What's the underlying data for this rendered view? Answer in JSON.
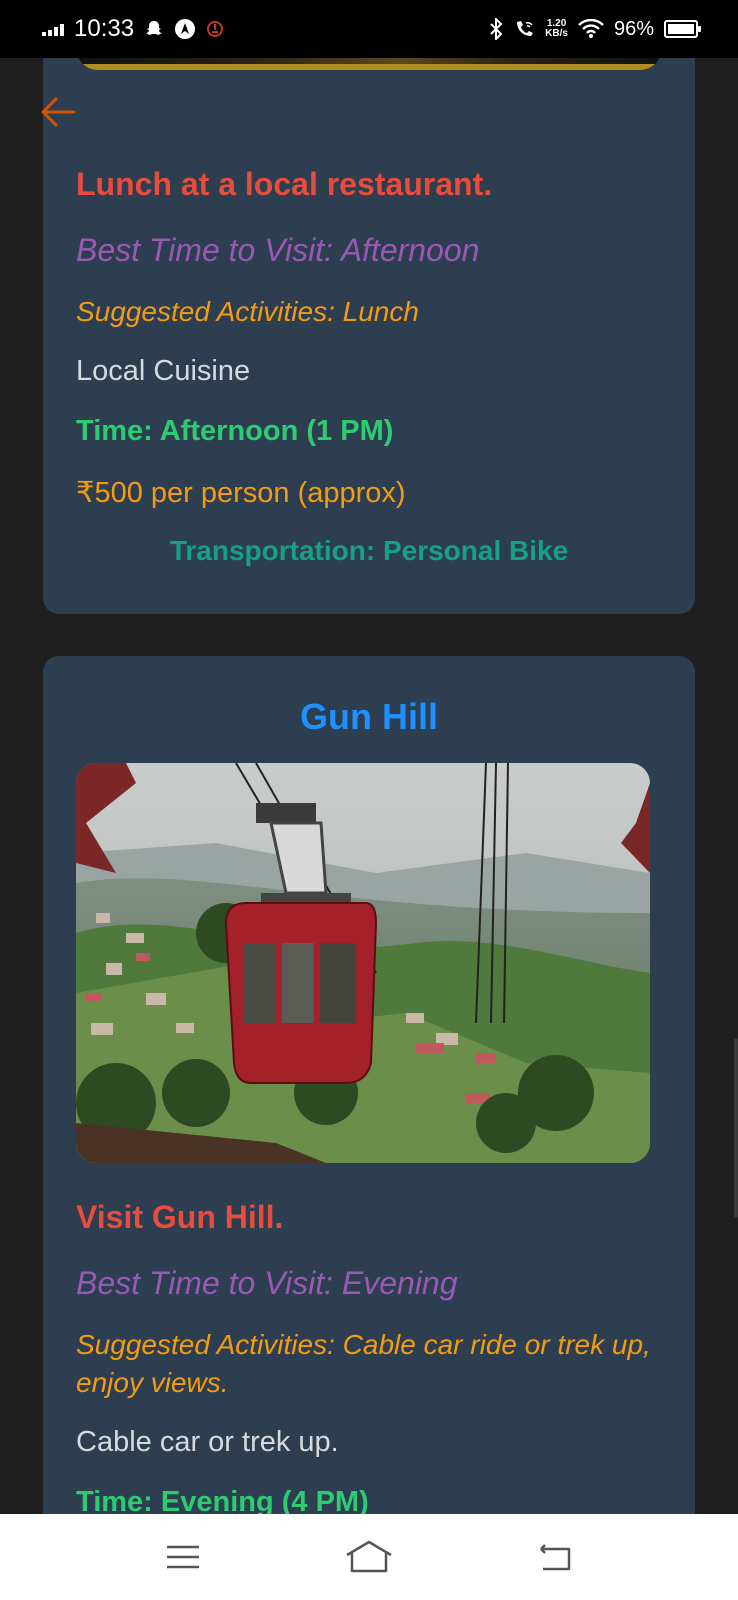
{
  "status_bar": {
    "time": "10:33",
    "speed_value": "1.20",
    "speed_unit": "KB/s",
    "battery": "96%"
  },
  "cards": [
    {
      "title": "Lunch at a local restaurant.",
      "best_time": "Best Time to Visit: Afternoon",
      "activities": "Suggested Activities: Lunch",
      "description": "Local Cuisine",
      "time": "Time: Afternoon (1 PM)",
      "cost": "₹500 per person (approx)",
      "transportation": "Transportation: Personal Bike"
    },
    {
      "place": "Gun Hill",
      "title": "Visit Gun Hill.",
      "best_time": "Best Time to Visit: Evening",
      "activities": "Suggested Activities: Cable car ride or trek up, enjoy views.",
      "description": "Cable car or trek up.",
      "time": "Time: Evening (4 PM)"
    }
  ],
  "colors": {
    "card_bg": "#2c3e50",
    "title": "#e74c3c",
    "best_time": "#9b59b6",
    "activities": "#f39c12",
    "time": "#2ecc71",
    "transport": "#16a085",
    "place": "#1e90ff"
  },
  "icons": [
    "back-arrow-icon",
    "snapchat-icon",
    "nav-icon",
    "bluetooth-icon",
    "wifi-call-icon",
    "wifi-icon",
    "battery-icon",
    "menu-icon",
    "home-icon",
    "back-icon"
  ]
}
